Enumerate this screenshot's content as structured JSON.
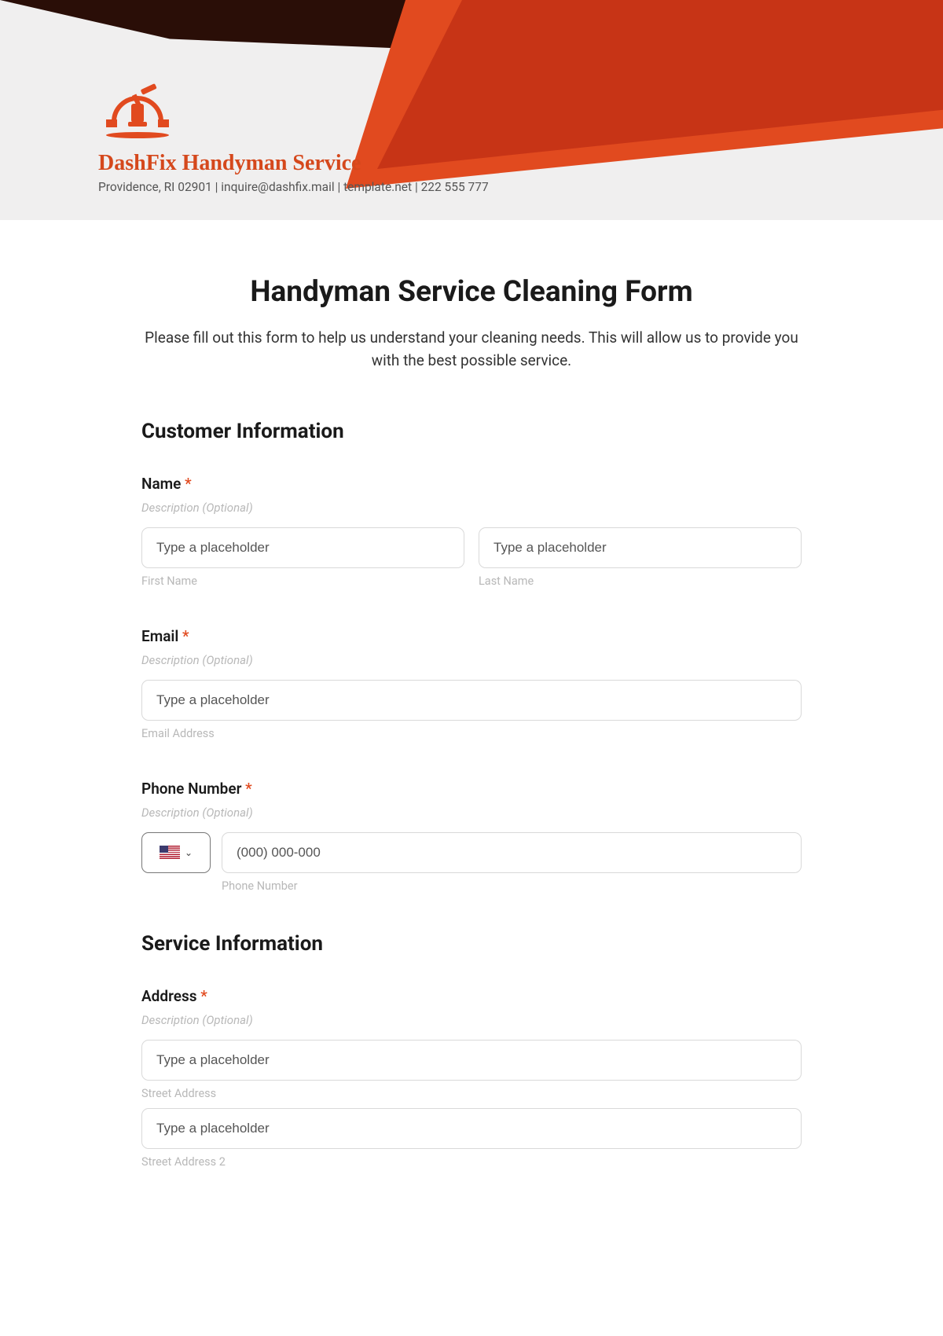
{
  "header": {
    "company_name": "DashFix Handyman Service",
    "company_info": "Providence, RI 02901 | inquire@dashfix.mail | template.net | 222 555 777"
  },
  "form": {
    "title": "Handyman Service Cleaning Form",
    "subtitle": "Please fill out this form to help us understand your cleaning needs. This will allow us to provide you with the best possible service."
  },
  "sections": {
    "customer": {
      "title": "Customer Information"
    },
    "service": {
      "title": "Service Information"
    }
  },
  "fields": {
    "name": {
      "label": "Name",
      "description": "Description (Optional)",
      "first_placeholder": "Type a placeholder",
      "last_placeholder": "Type a placeholder",
      "first_sublabel": "First Name",
      "last_sublabel": "Last Name"
    },
    "email": {
      "label": "Email",
      "description": "Description (Optional)",
      "placeholder": "Type a placeholder",
      "sublabel": "Email Address"
    },
    "phone": {
      "label": "Phone Number",
      "description": "Description (Optional)",
      "placeholder": "(000) 000-000",
      "sublabel": "Phone Number"
    },
    "address": {
      "label": "Address",
      "description": "Description (Optional)",
      "street1_placeholder": "Type a placeholder",
      "street2_placeholder": "Type a placeholder",
      "street1_sublabel": "Street Address",
      "street2_sublabel": "Street Address 2"
    }
  },
  "required_marker": "*"
}
